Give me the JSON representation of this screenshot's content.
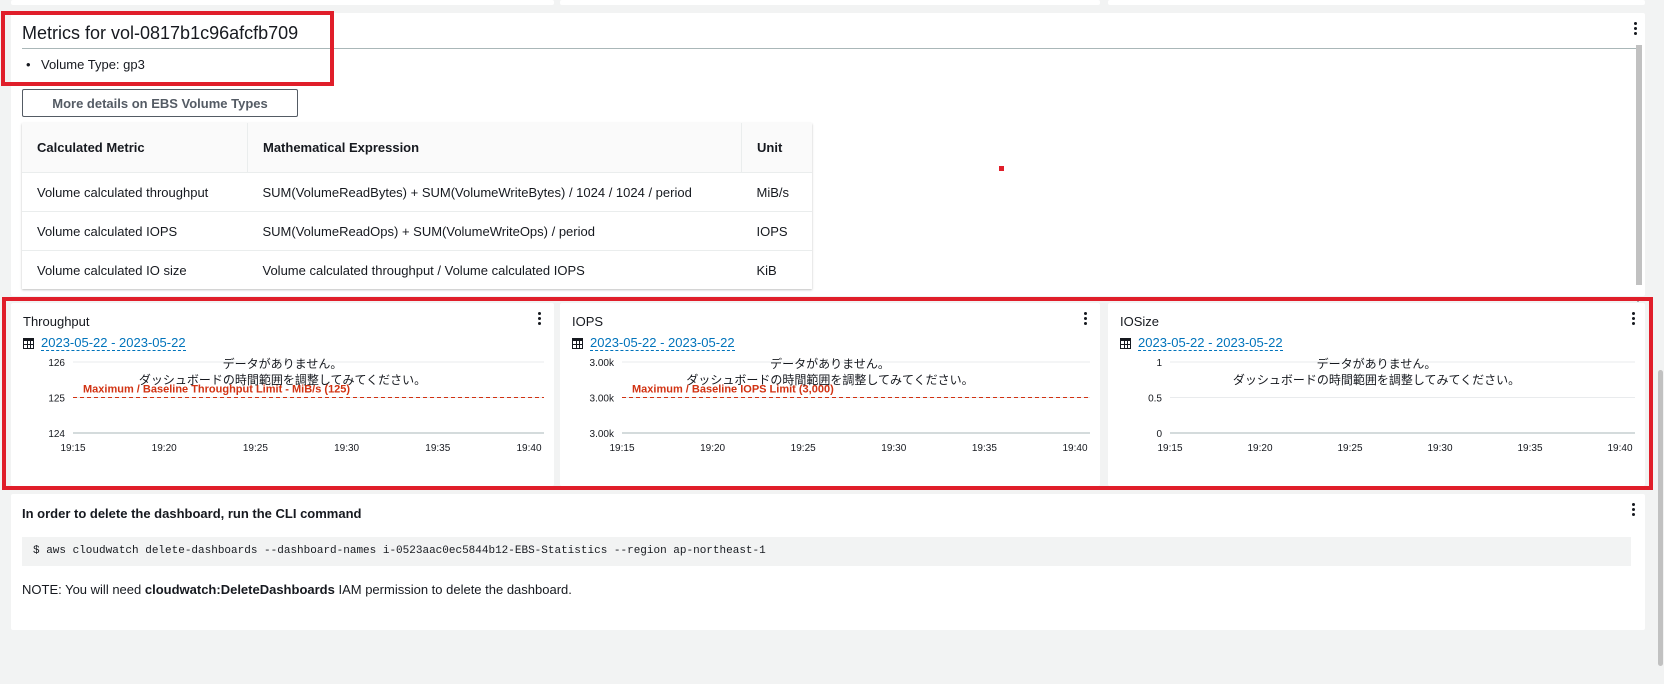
{
  "metrics_widget": {
    "title": "Metrics for vol-0817b1c96afcfb709",
    "bullets": [
      "Volume Type: gp3"
    ],
    "details_button": "More details on EBS Volume Types",
    "table": {
      "headers": [
        "Calculated Metric",
        "Mathematical Expression",
        "Unit"
      ],
      "rows": [
        [
          "Volume calculated throughput",
          "SUM(VolumeReadBytes) + SUM(VolumeWriteBytes) / 1024 / 1024 / period",
          "MiB/s"
        ],
        [
          "Volume calculated IOPS",
          "SUM(VolumeReadOps) + SUM(VolumeWriteOps) / period",
          "IOPS"
        ],
        [
          "Volume calculated IO size",
          "Volume calculated throughput / Volume calculated IOPS",
          "KiB"
        ]
      ]
    }
  },
  "chart_data": [
    {
      "type": "line",
      "title": "Throughput",
      "date_range": "2023-05-22 - 2023-05-22",
      "no_data_line1": "データがありません。",
      "no_data_line2": "ダッシュボードの時間範囲を調整してみてください。",
      "x_ticks": [
        "19:15",
        "19:20",
        "19:25",
        "19:30",
        "19:35",
        "19:40"
      ],
      "y_ticks": [
        "126",
        "125",
        "124"
      ],
      "ylim": [
        124,
        126
      ],
      "series": [],
      "annotation": {
        "label": "Maximum / Baseline Throughput Limit - MiB/s (125)",
        "value": 125,
        "color": "#d13212"
      }
    },
    {
      "type": "line",
      "title": "IOPS",
      "date_range": "2023-05-22 - 2023-05-22",
      "no_data_line1": "データがありません。",
      "no_data_line2": "ダッシュボードの時間範囲を調整してみてください。",
      "x_ticks": [
        "19:15",
        "19:20",
        "19:25",
        "19:30",
        "19:35",
        "19:40"
      ],
      "y_ticks": [
        "3.00k",
        "3.00k",
        "3.00k"
      ],
      "ylim": [
        2999,
        3001
      ],
      "series": [],
      "annotation": {
        "label": "Maximum / Baseline IOPS Limit (3,000)",
        "value": 3000,
        "color": "#d13212"
      }
    },
    {
      "type": "line",
      "title": "IOSize",
      "date_range": "2023-05-22 - 2023-05-22",
      "no_data_line1": "データがありません。",
      "no_data_line2": "ダッシュボードの時間範囲を調整してみてください。",
      "x_ticks": [
        "19:15",
        "19:20",
        "19:25",
        "19:30",
        "19:35",
        "19:40"
      ],
      "y_ticks": [
        "1",
        "0.5",
        "0"
      ],
      "ylim": [
        0,
        1
      ],
      "series": [],
      "annotation": null
    }
  ],
  "cli_widget": {
    "heading": "In order to delete the dashboard, run the CLI command",
    "command": "$ aws cloudwatch delete-dashboards --dashboard-names i-0523aac0ec5844b12-EBS-Statistics --region ap-northeast-1",
    "note_prefix": "NOTE: You will need ",
    "note_bold": "cloudwatch:DeleteDashboards",
    "note_suffix": " IAM permission to delete the dashboard."
  },
  "colors": {
    "highlight": "#e01e2a",
    "link": "#0073bb",
    "limit_line": "#d13212"
  }
}
